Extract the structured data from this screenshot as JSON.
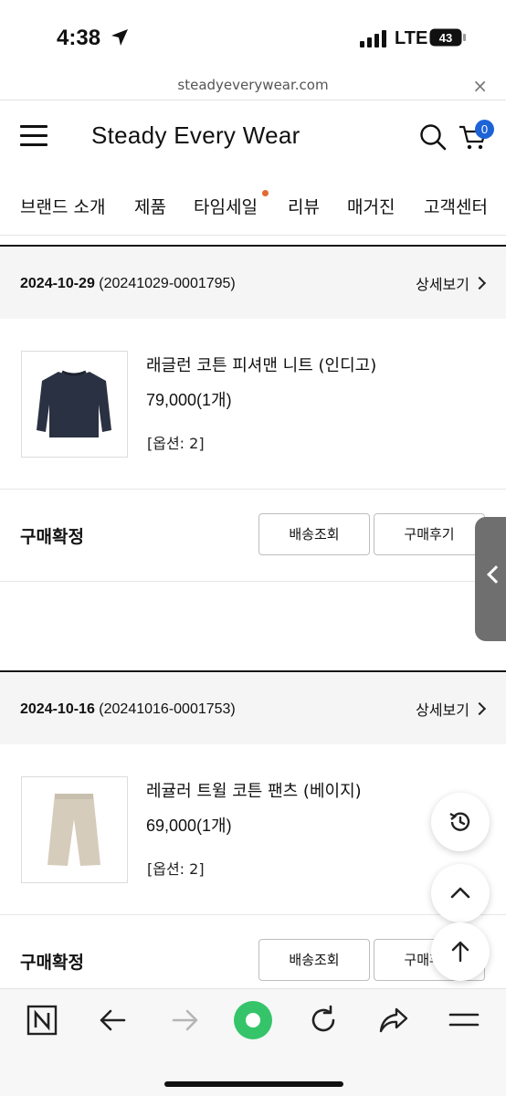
{
  "status_bar": {
    "time": "4:38",
    "network": "LTE",
    "battery": "43"
  },
  "browser": {
    "url": "steadyeverywear.com",
    "close_label": "×"
  },
  "header": {
    "brand": "Steady Every Wear",
    "cart_count": "0"
  },
  "nav": {
    "items": [
      "브랜드 소개",
      "제품",
      "타임세일",
      "리뷰",
      "매거진",
      "고객센터"
    ]
  },
  "orders": [
    {
      "date": "2024-10-29",
      "order_number": "(20241029-0001795)",
      "detail_label": "상세보기",
      "product_name": "래글런 코튼 피셔맨 니트 (인디고)",
      "price": "79,000(1개)",
      "option": "[옵션: 2]",
      "status": "구매확정",
      "buttons": [
        "배송조회",
        "구매후기"
      ]
    },
    {
      "date": "2024-10-16",
      "order_number": "(20241016-0001753)",
      "detail_label": "상세보기",
      "product_name": "레귤러 트윌 코튼 팬츠 (베이지)",
      "price": "69,000(1개)",
      "option": "[옵션: 2]",
      "status": "구매확정",
      "buttons": [
        "배송조회",
        "구매후기"
      ]
    }
  ],
  "colors": {
    "accent": "#1d63d8",
    "sale_dot": "#e4682f",
    "reload_green": "#35c46a"
  },
  "icons": [
    "menu-icon",
    "search-icon",
    "cart-icon",
    "history-icon",
    "chevron-up-icon",
    "arrow-up-icon",
    "naver-icon",
    "back-icon",
    "forward-icon",
    "reload-icon",
    "share-icon",
    "more-menu-icon"
  ]
}
